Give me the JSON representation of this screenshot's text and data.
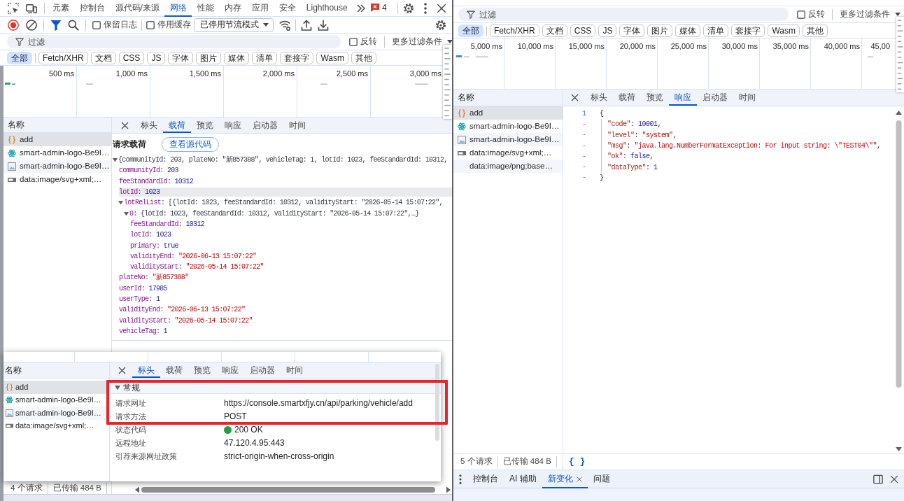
{
  "left_devtools": {
    "panel_tabs": [
      {
        "label": "元素",
        "selected": false
      },
      {
        "label": "控制台",
        "selected": false
      },
      {
        "label": "源代码/来源",
        "selected": false
      },
      {
        "label": "网络",
        "selected": true
      },
      {
        "label": "性能",
        "selected": false
      },
      {
        "label": "内存",
        "selected": false
      },
      {
        "label": "应用",
        "selected": false
      },
      {
        "label": "安全",
        "selected": false
      },
      {
        "label": "Lighthouse",
        "selected": false
      }
    ],
    "issues_count": "4",
    "toolbar": {
      "preserve_log": {
        "label": "保留日志",
        "checked": false
      },
      "disable_cache": {
        "label": "停用缓存",
        "checked": false
      },
      "throttling": "已停用节流模式"
    },
    "filter": {
      "placeholder": "过滤",
      "invert": {
        "label": "反转",
        "checked": false
      },
      "more_filters": "更多过滤条件"
    },
    "type_filters": [
      {
        "label": "全部",
        "selected": true
      },
      {
        "label": "Fetch/XHR",
        "selected": false
      },
      {
        "label": "文档",
        "selected": false
      },
      {
        "label": "CSS",
        "selected": false
      },
      {
        "label": "JS",
        "selected": false
      },
      {
        "label": "字体",
        "selected": false
      },
      {
        "label": "图片",
        "selected": false
      },
      {
        "label": "媒体",
        "selected": false
      },
      {
        "label": "清单",
        "selected": false
      },
      {
        "label": "套接字",
        "selected": false
      },
      {
        "label": "Wasm",
        "selected": false
      },
      {
        "label": "其他",
        "selected": false
      }
    ],
    "timeline_ticks": [
      "500 ms",
      "1,000 ms",
      "1,500 ms",
      "2,000 ms",
      "2,500 ms",
      "3,000 ms"
    ],
    "requests": {
      "header": "名称",
      "items": [
        {
          "name": "add",
          "kind": "xhr",
          "selected": true
        },
        {
          "name": "smart-admin-logo-Be9I…",
          "kind": "atom",
          "selected": false
        },
        {
          "name": "smart-admin-logo-Be9I…",
          "kind": "image",
          "selected": false
        },
        {
          "name": "data:image/svg+xml;…",
          "kind": "svg",
          "selected": false
        }
      ]
    },
    "detail_tabs": [
      {
        "label": "标头",
        "selected": false
      },
      {
        "label": "载荷",
        "selected": true
      },
      {
        "label": "预览",
        "selected": false
      },
      {
        "label": "响应",
        "selected": false
      },
      {
        "label": "启动器",
        "selected": false
      },
      {
        "label": "时间",
        "selected": false
      }
    ],
    "payload": {
      "title": "请求载荷",
      "view_source": "查看源代码",
      "tree": {
        "summary": "{communityId: 203, plateNo: \"新857388\", vehicleTag: 1, lotId: 1023, feeStandardId: 10312,",
        "expanded": true,
        "hovered": false,
        "children": [
          {
            "key": "communityId:",
            "value": "203",
            "kind": "number",
            "hovered": false
          },
          {
            "key": "feeStandardId:",
            "value": "10312",
            "kind": "number",
            "hovered": false
          },
          {
            "key": "lotId:",
            "value": "1023",
            "kind": "number",
            "hovered": true
          },
          {
            "key": "lotRelList:",
            "summary": "[{lotId: 1023, feeStandardId: 10312, validityStart: \"2026-05-14 15:07:22\",",
            "expanded": true,
            "hovered": false,
            "children": [
              {
                "key": "0:",
                "summary": "{lotId: 1023, feeStandardId: 10312, validityStart: \"2026-05-14 15:07:22\",…}",
                "expanded": true,
                "hovered": false,
                "children": [
                  {
                    "key": "feeStandardId:",
                    "value": "10312",
                    "kind": "number",
                    "hovered": false
                  },
                  {
                    "key": "lotId:",
                    "value": "1023",
                    "kind": "number",
                    "hovered": false
                  },
                  {
                    "key": "primary:",
                    "value": "true",
                    "kind": "boolean",
                    "hovered": false
                  },
                  {
                    "key": "validityEnd:",
                    "value": "\"2026-06-13 15:07:22\"",
                    "kind": "string",
                    "hovered": false
                  },
                  {
                    "key": "validityStart:",
                    "value": "\"2026-05-14 15:07:22\"",
                    "kind": "string",
                    "hovered": false
                  }
                ]
              }
            ]
          },
          {
            "key": "plateNo:",
            "value": "\"新857388\"",
            "kind": "string",
            "hovered": false
          },
          {
            "key": "userId:",
            "value": "17985",
            "kind": "number",
            "hovered": false
          },
          {
            "key": "userType:",
            "value": "1",
            "kind": "number",
            "hovered": false
          },
          {
            "key": "validityEnd:",
            "value": "\"2026-06-13 15:07:22\"",
            "kind": "string",
            "hovered": false
          },
          {
            "key": "validityStart:",
            "value": "\"2026-05-14 15:07:22\"",
            "kind": "string",
            "hovered": false
          },
          {
            "key": "vehicleTag:",
            "value": "1",
            "kind": "number",
            "hovered": false
          }
        ]
      }
    },
    "status_bar": {
      "requests": "4 个请求",
      "transferred": "已传输 484 B"
    }
  },
  "inset_screenshot": {
    "requests": {
      "header": "名称",
      "items": [
        {
          "name": "add",
          "kind": "xhr",
          "selected": true
        },
        {
          "name": "smart-admin-logo-Be9I…",
          "kind": "atom",
          "selected": false
        },
        {
          "name": "smart-admin-logo-Be9I…",
          "kind": "image",
          "selected": false
        },
        {
          "name": "data:image/svg+xml;…",
          "kind": "svg",
          "selected": false
        }
      ]
    },
    "detail_tabs": [
      {
        "label": "标头",
        "selected": true
      },
      {
        "label": "载荷",
        "selected": false
      },
      {
        "label": "预览",
        "selected": false
      },
      {
        "label": "响应",
        "selected": false
      },
      {
        "label": "启动器",
        "selected": false
      },
      {
        "label": "时间",
        "selected": false
      }
    ],
    "general": {
      "title": "常规",
      "expanded": true,
      "rows": [
        {
          "label": "请求网址",
          "value": "https://console.smartxfjy.cn/api/parking/vehicle/add"
        },
        {
          "label": "请求方法",
          "value": "POST"
        },
        {
          "label": "状态代码",
          "value": "200 OK",
          "color": "#1e9e47"
        },
        {
          "label": "远程地址",
          "value": "47.120.4.95:443"
        },
        {
          "label": "引荐来源网址政策",
          "value": "strict-origin-when-cross-origin"
        }
      ]
    }
  },
  "right_devtools": {
    "filter": {
      "placeholder": "过滤",
      "invert": {
        "label": "反转",
        "checked": false
      },
      "more_filters": "更多过滤条件"
    },
    "type_filters": [
      {
        "label": "全部",
        "selected": true
      },
      {
        "label": "Fetch/XHR",
        "selected": false
      },
      {
        "label": "文档",
        "selected": false
      },
      {
        "label": "CSS",
        "selected": false
      },
      {
        "label": "JS",
        "selected": false
      },
      {
        "label": "字体",
        "selected": false
      },
      {
        "label": "图片",
        "selected": false
      },
      {
        "label": "媒体",
        "selected": false
      },
      {
        "label": "清单",
        "selected": false
      },
      {
        "label": "套接字",
        "selected": false
      },
      {
        "label": "Wasm",
        "selected": false
      },
      {
        "label": "其他",
        "selected": false
      }
    ],
    "timeline_ticks": [
      "5,000 ms",
      "10,000 ms",
      "15,000 ms",
      "20,000 ms",
      "25,000 ms",
      "30,000 ms",
      "35,000 ms",
      "40,000 ms",
      "45,00"
    ],
    "requests": {
      "header": "名称",
      "items": [
        {
          "name": "add",
          "kind": "xhr",
          "selected": true
        },
        {
          "name": "smart-admin-logo-Be9I…",
          "kind": "atom",
          "selected": false
        },
        {
          "name": "smart-admin-logo-Be9I…",
          "kind": "image",
          "selected": false
        },
        {
          "name": "data:image/svg+xml;…",
          "kind": "svg",
          "selected": false
        },
        {
          "name": "data:image/png;base…",
          "kind": "png",
          "selected": false
        }
      ]
    },
    "detail_tabs": [
      {
        "label": "标头",
        "selected": false
      },
      {
        "label": "载荷",
        "selected": false
      },
      {
        "label": "预览",
        "selected": false
      },
      {
        "label": "响应",
        "selected": true
      },
      {
        "label": "启动器",
        "selected": false
      },
      {
        "label": "时间",
        "selected": false
      }
    ],
    "response": {
      "lines": [
        {
          "number": "1",
          "tokens": [
            {
              "kind": "punct",
              "text": "{"
            }
          ],
          "children": [
            {
              "number": "-",
              "tokens": [
                {
                  "kind": "key",
                  "text": "\"code\""
                },
                {
                  "kind": "punct",
                  "text": ": "
                },
                {
                  "kind": "number",
                  "text": "10001"
                },
                {
                  "kind": "punct",
                  "text": ","
                }
              ]
            },
            {
              "number": "-",
              "tokens": [
                {
                  "kind": "key",
                  "text": "\"level\""
                },
                {
                  "kind": "punct",
                  "text": ": "
                },
                {
                  "kind": "string",
                  "text": "\"system\""
                },
                {
                  "kind": "punct",
                  "text": ","
                }
              ]
            },
            {
              "number": "-",
              "tokens": [
                {
                  "kind": "key",
                  "text": "\"msg\""
                },
                {
                  "kind": "punct",
                  "text": ": "
                },
                {
                  "kind": "string",
                  "text": "\"java.lang.NumberFormatException: For input string: \\\"TEST04\\\"\""
                },
                {
                  "kind": "punct",
                  "text": ","
                }
              ]
            },
            {
              "number": "-",
              "tokens": [
                {
                  "kind": "key",
                  "text": "\"ok\""
                },
                {
                  "kind": "punct",
                  "text": ": "
                },
                {
                  "kind": "keyword",
                  "text": "false"
                },
                {
                  "kind": "punct",
                  "text": ","
                }
              ]
            },
            {
              "number": "-",
              "tokens": [
                {
                  "kind": "key",
                  "text": "\"dataType\""
                },
                {
                  "kind": "punct",
                  "text": ": "
                },
                {
                  "kind": "number",
                  "text": "1"
                }
              ]
            }
          ]
        },
        {
          "number": "-",
          "tokens": [
            {
              "kind": "punct",
              "text": "}"
            }
          ]
        }
      ]
    },
    "status_bar": {
      "requests": "5 个请求",
      "transferred": "已传输 484 B",
      "pretty_print": "{ }"
    },
    "drawer_tabs": [
      {
        "label": "控制台",
        "selected": false,
        "closable": false
      },
      {
        "label": "AI 辅助",
        "selected": false,
        "closable": false
      },
      {
        "label": "新变化",
        "selected": true,
        "closable": true
      },
      {
        "label": "问题",
        "selected": false,
        "closable": false
      }
    ]
  }
}
